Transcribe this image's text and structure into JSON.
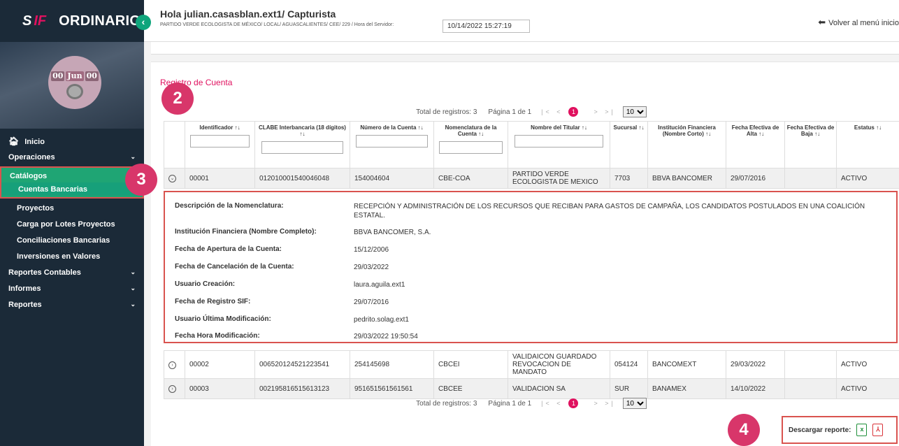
{
  "brand": {
    "logo_s": "S",
    "logo_f": "IF",
    "title": "ORDINARIO",
    "collapse_glyph": "‹"
  },
  "avatar": {
    "left": "00",
    "mid": "Jun",
    "right": "00"
  },
  "header": {
    "greeting": "Hola julian.casasblan.ext1/ Capturista",
    "path": "PARTIDO VERDE ECOLOGISTA DE MÉXICO/ LOCAL/ AGUASCALIENTES/ CEE/ 229 / Hora del Servidor:",
    "server_time": "10/14/2022 15:27:19",
    "back_label": "Volver al menú inicio"
  },
  "nav": {
    "inicio": "Inicio",
    "operaciones": "Operaciones",
    "catalogos": "Catálogos",
    "cuentas": "Cuentas Bancarias",
    "proyectos": "Proyectos",
    "carga": "Carga por Lotes Proyectos",
    "conciliaciones": "Conciliaciones Bancarias",
    "inversiones": "Inversiones en Valores",
    "reportes_contables": "Reportes Contables",
    "informes": "Informes",
    "reportes": "Reportes"
  },
  "page_title": "Registro de Cuenta",
  "badges": {
    "b2": "2",
    "b3": "3",
    "b4": "4"
  },
  "pager": {
    "total": "Total de registros: 3",
    "page": "Página 1 de 1",
    "arrows_prev": "|< <",
    "arrows_next": "> >|",
    "current": "1",
    "page_size": "10"
  },
  "columns": {
    "id": "Identificador",
    "clabe": "CLABE Interbancaria (18 dígitos)",
    "numero": "Número de la Cuenta",
    "nomen": "Nomenclatura de la Cuenta",
    "titular": "Nombre del Titular",
    "sucursal": "Sucursal",
    "institucion": "Institución Financiera (Nombre Corto)",
    "alta": "Fecha Efectiva de Alta",
    "baja": "Fecha Efectiva de Baja",
    "estatus": "Estatus"
  },
  "rows": [
    {
      "toggle": "⌄",
      "id": "00001",
      "clabe": "012010001540046048",
      "numero": "154004604",
      "nomen": "CBE-COA",
      "titular": "PARTIDO VERDE ECOLOGISTA DE MEXICO",
      "sucursal": "7703",
      "institucion": "BBVA BANCOMER",
      "alta": "29/07/2016",
      "baja": "",
      "estatus": "ACTIVO"
    },
    {
      "toggle": "›",
      "id": "00002",
      "clabe": "006520124521223541",
      "numero": "254145698",
      "nomen": "CBCEI",
      "titular": "VALIDAICON GUARDADO REVOCACION DE MANDATO",
      "sucursal": "054124",
      "institucion": "BANCOMEXT",
      "alta": "29/03/2022",
      "baja": "",
      "estatus": "ACTIVO"
    },
    {
      "toggle": "›",
      "id": "00003",
      "clabe": "002195816515613123",
      "numero": "951651561561561",
      "nomen": "CBCEE",
      "titular": "VALIDACION SA",
      "sucursal": "SUR",
      "institucion": "BANAMEX",
      "alta": "14/10/2022",
      "baja": "",
      "estatus": "ACTIVO"
    }
  ],
  "detail": {
    "desc_label": "Descripción de la Nomenclatura:",
    "desc_value": "RECEPCIÓN Y ADMINISTRACIÓN DE LOS RECURSOS QUE RECIBAN PARA GASTOS DE CAMPAÑA, LOS CANDIDATOS POSTULADOS EN UNA COALICIÓN ESTATAL.",
    "inst_label": "Institución Financiera (Nombre Completo):",
    "inst_value": "BBVA BANCOMER, S.A.",
    "apertura_label": "Fecha de Apertura de la Cuenta:",
    "apertura_value": "15/12/2006",
    "cancel_label": "Fecha de Cancelación de la Cuenta:",
    "cancel_value": "29/03/2022",
    "usuario_label": "Usuario Creación:",
    "usuario_value": "laura.aguila.ext1",
    "registro_label": "Fecha de Registro SIF:",
    "registro_value": "29/07/2016",
    "ultmod_label": "Usuario Última Modificación:",
    "ultmod_value": "pedrito.solag.ext1",
    "horamod_label": "Fecha Hora Modificación:",
    "horamod_value": "29/03/2022 19:50:54"
  },
  "download": {
    "label": "Descargar reporte:",
    "xls": "x",
    "pdf": "⅄"
  }
}
